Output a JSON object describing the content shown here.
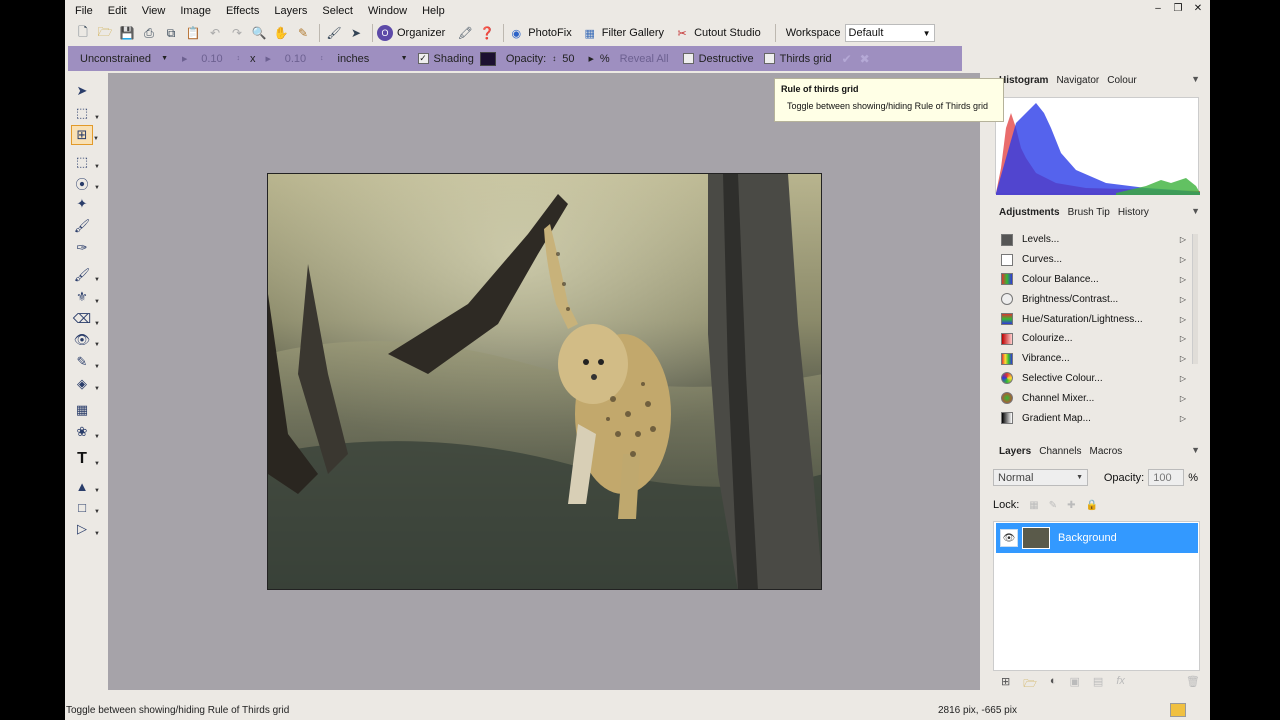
{
  "menu": [
    "File",
    "Edit",
    "View",
    "Image",
    "Effects",
    "Layers",
    "Select",
    "Window",
    "Help"
  ],
  "toolbar": {
    "organizer": "Organizer",
    "photofix": "PhotoFix",
    "filter_gallery": "Filter Gallery",
    "cutout_studio": "Cutout Studio",
    "workspace_label": "Workspace",
    "workspace_value": "Default"
  },
  "options": {
    "constraint": "Unconstrained",
    "width": "0.10",
    "by": "x",
    "height": "0.10",
    "units": "inches",
    "shading": "Shading",
    "opacity_label": "Opacity:",
    "opacity_value": "50",
    "percent": "%",
    "reveal_all": "Reveal All",
    "destructive": "Destructive",
    "thirds_grid": "Thirds grid"
  },
  "tooltip": {
    "title": "Rule of thirds grid",
    "body": "Toggle between showing/hiding Rule of Thirds grid"
  },
  "panels": {
    "top_tabs": [
      "Histogram",
      "Navigator",
      "Colour"
    ],
    "mid_tabs": [
      "Adjustments",
      "Brush Tip",
      "History"
    ],
    "adjustments": [
      {
        "label": "Levels...",
        "icon": "levels-icon"
      },
      {
        "label": "Curves...",
        "icon": "curves-icon"
      },
      {
        "label": "Colour Balance...",
        "icon": "colour-balance-icon"
      },
      {
        "label": "Brightness/Contrast...",
        "icon": "brightness-icon"
      },
      {
        "label": "Hue/Saturation/Lightness...",
        "icon": "hue-icon"
      },
      {
        "label": "Colourize...",
        "icon": "colourize-icon"
      },
      {
        "label": "Vibrance...",
        "icon": "vibrance-icon"
      },
      {
        "label": "Selective Colour...",
        "icon": "selective-colour-icon"
      },
      {
        "label": "Channel Mixer...",
        "icon": "channel-mixer-icon"
      },
      {
        "label": "Gradient Map...",
        "icon": "gradient-map-icon"
      }
    ],
    "layer_tabs": [
      "Layers",
      "Channels",
      "Macros"
    ],
    "blend_mode": "Normal",
    "layer_opacity_label": "Opacity:",
    "layer_opacity_value": "100",
    "layer_opacity_unit": "%",
    "lock_label": "Lock:",
    "layer_name": "Background"
  },
  "status": {
    "text": "Toggle between showing/hiding Rule of Thirds grid",
    "coords": "2816 pix, -665 pix"
  },
  "colors": {
    "option_bar": "#9e8fc0",
    "selection": "#3399ff",
    "canvas_bg": "#a6a3a9"
  }
}
